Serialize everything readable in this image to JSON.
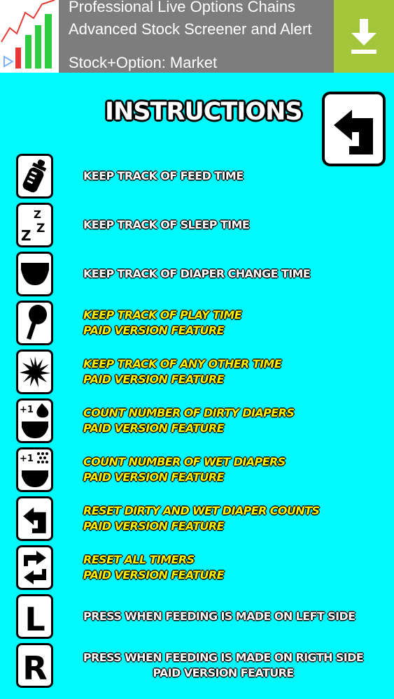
{
  "ad": {
    "line1": "Professional Live Options Chains",
    "line2": "Advanced Stock Screener and Alert",
    "line3": "Stock+Option: Market",
    "download_icon": "download-arrow-icon",
    "info_icon": "ad-choices-icon",
    "colors": {
      "download_bg": "#a4c63a",
      "banner_bg": "#7d7d7d"
    }
  },
  "header": {
    "title": "INSTRUCTIONS",
    "back_icon": "return-arrow-icon"
  },
  "colors": {
    "background": "#00f9fb",
    "free_text": "#ffffff",
    "paid_text": "#fff200"
  },
  "rows": [
    {
      "icon": "baby-bottle-icon",
      "line1": "KEEP TRACK OF FEED TIME"
    },
    {
      "icon": "sleep-zzz-icon",
      "line1": "KEEP TRACK OF SLEEP TIME"
    },
    {
      "icon": "diaper-icon",
      "line1": "KEEP TRACK OF DIAPER CHANGE TIME"
    },
    {
      "icon": "rattle-icon",
      "line1": "KEEP TRACK OF PLAY TIME",
      "line2": "PAID VERSION FEATURE"
    },
    {
      "icon": "starburst-icon",
      "line1": "KEEP TRACK OF ANY OTHER TIME",
      "line2": "PAID VERSION FEATURE"
    },
    {
      "icon": "dirty-diaper-plus-one-icon",
      "badge": "+1",
      "line1": "COUNT NUMBER OF DIRTY DIAPERS",
      "line2": "PAID VERSION FEATURE"
    },
    {
      "icon": "wet-diaper-plus-one-icon",
      "badge": "+1",
      "line1": "COUNT NUMBER OF WET DIAPERS",
      "line2": "PAID VERSION FEATURE"
    },
    {
      "icon": "reset-counts-arrow-icon",
      "line1": "RESET DIRTY AND WET DIAPER COUNTS",
      "line2": "PAID VERSION FEATURE"
    },
    {
      "icon": "reset-all-arrows-icon",
      "line1": "RESET ALL TIMERS",
      "line2": "PAID VERSION FEATURE"
    },
    {
      "icon": "left-side-letter-icon",
      "letter": "L",
      "line1": "PRESS WHEN FEEDING IS MADE ON LEFT SIDE"
    },
    {
      "icon": "right-side-letter-icon",
      "letter": "R",
      "line1": "PRESS WHEN FEEDING IS MADE ON RIGTH SIDE",
      "line2": "PAID VERSION FEATURE"
    }
  ]
}
